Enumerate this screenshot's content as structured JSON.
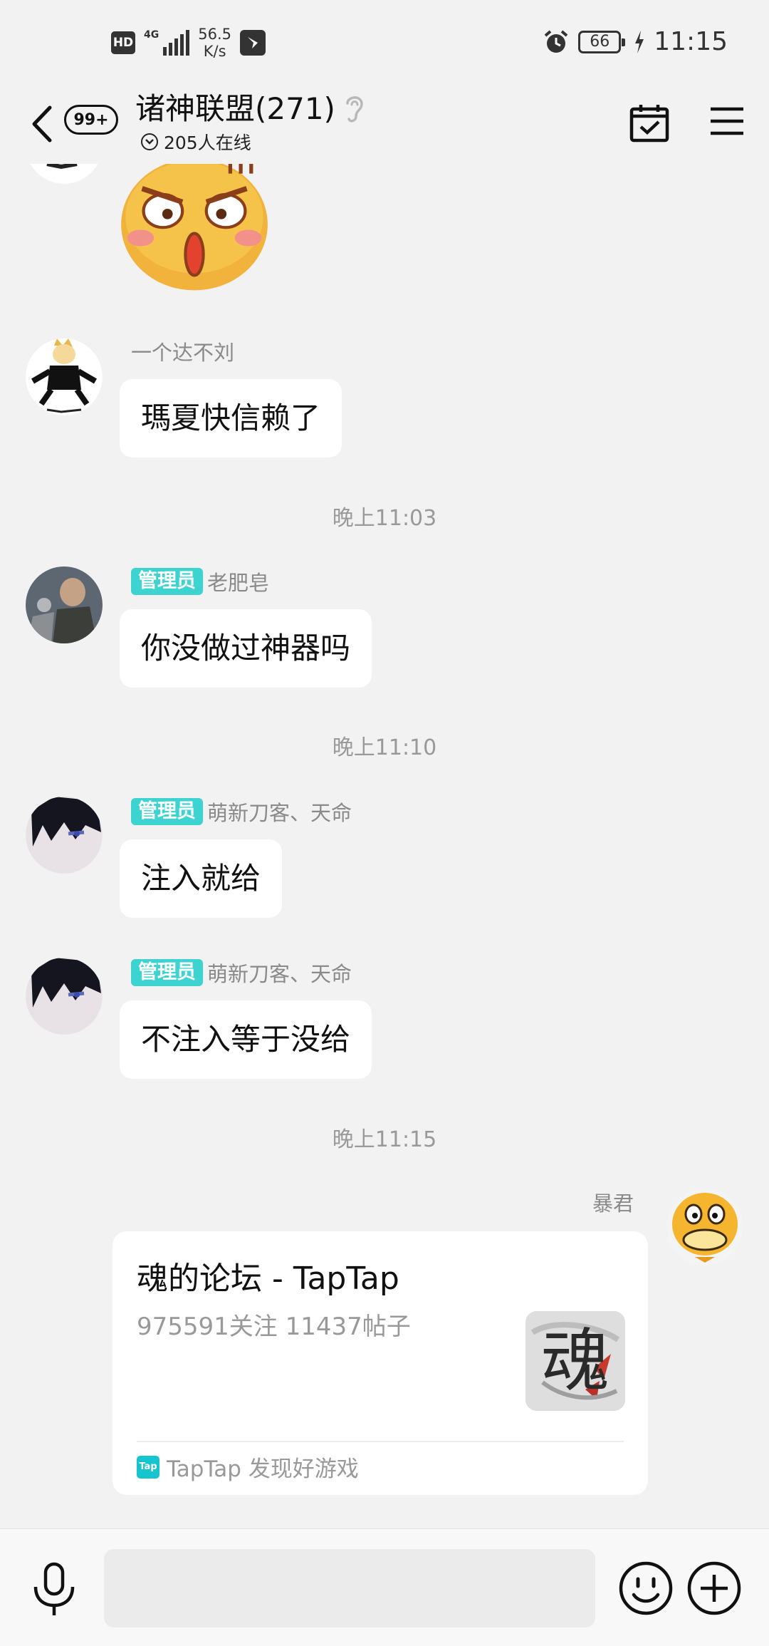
{
  "status_bar": {
    "hd": "HD",
    "network": "4G",
    "speed_value": "56.5",
    "speed_unit": "K/s",
    "battery": "66",
    "time": "11:15",
    "icons": [
      "signal-icon",
      "app-notification-icon",
      "alarm-icon",
      "battery-icon",
      "charging-icon"
    ]
  },
  "header": {
    "unread_badge": "99+",
    "title": "诸神联盟(271)",
    "online": "205人在线",
    "icons": [
      "back-arrow-icon",
      "ear-icon",
      "calendar-check-icon",
      "menu-icon"
    ]
  },
  "messages": [
    {
      "sender": "一个达不刘",
      "text": "瑪夏快信赖了",
      "admin": false
    },
    {
      "time": "晚上11:03"
    },
    {
      "sender": "老肥皂",
      "admin_label": "管理员",
      "text": "你没做过神器吗"
    },
    {
      "time": "晚上11:10"
    },
    {
      "sender": "萌新刀客、天命",
      "admin_label": "管理员",
      "text": "注入就给"
    },
    {
      "sender": "萌新刀客、天命",
      "admin_label": "管理员",
      "text": "不注入等于没给"
    },
    {
      "time": "晚上11:15"
    }
  ],
  "shared_card": {
    "sender": "暴君",
    "title": "魂的论坛 - TapTap",
    "stats": "975591关注 11437帖子",
    "thumb_text": "魂",
    "source_logo": "Tap",
    "source": "TapTap 发现好游戏"
  },
  "input_bar": {
    "placeholder": "",
    "icons": [
      "microphone-icon",
      "emoji-icon",
      "plus-icon"
    ]
  },
  "colors": {
    "background": "#f2f2f2",
    "admin_tag": "#3dd3d0",
    "bubble": "#ffffff",
    "taptap": "#15c5ce"
  }
}
